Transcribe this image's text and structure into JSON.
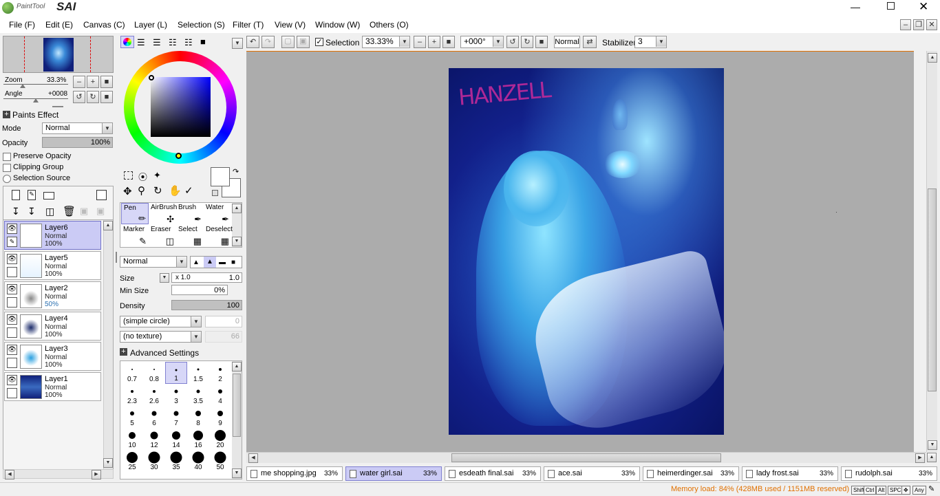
{
  "app": {
    "logo_small": "PaintTool",
    "logo_big": "SAI"
  },
  "menu": [
    "File (F)",
    "Edit (E)",
    "Canvas (C)",
    "Layer (L)",
    "Selection (S)",
    "Filter (T)",
    "View (V)",
    "Window (W)",
    "Others (O)"
  ],
  "navigator": {
    "zoom_label": "Zoom",
    "zoom_value": "33.3%",
    "angle_label": "Angle",
    "angle_value": "+0008"
  },
  "paints_effect": {
    "header": "Paints Effect",
    "mode_label": "Mode",
    "mode_value": "Normal",
    "opacity_label": "Opacity",
    "opacity_value": "100%",
    "opacity_fraction": 1.0
  },
  "layer_options": {
    "preserve_opacity": "Preserve Opacity",
    "clipping_group": "Clipping Group",
    "selection_source": "Selection Source"
  },
  "layers": [
    {
      "name": "Layer6",
      "mode": "Normal",
      "opacity": "100%",
      "active": true
    },
    {
      "name": "Layer5",
      "mode": "Normal",
      "opacity": "100%",
      "active": false
    },
    {
      "name": "Layer2",
      "mode": "Normal",
      "opacity": "50%",
      "active": false
    },
    {
      "name": "Layer4",
      "mode": "Normal",
      "opacity": "100%",
      "active": false
    },
    {
      "name": "Layer3",
      "mode": "Normal",
      "opacity": "100%",
      "active": false
    },
    {
      "name": "Layer1",
      "mode": "Normal",
      "opacity": "100%",
      "active": false
    }
  ],
  "tools": [
    {
      "name": "Pen",
      "icon": "pen-icon",
      "active": true
    },
    {
      "name": "AirBrush",
      "icon": "airbrush-icon",
      "active": false
    },
    {
      "name": "Brush",
      "icon": "brush-icon",
      "active": false
    },
    {
      "name": "Water",
      "icon": "water-icon",
      "active": false
    },
    {
      "name": "Marker",
      "icon": "marker-icon",
      "active": false
    },
    {
      "name": "Eraser",
      "icon": "eraser-icon",
      "active": false
    },
    {
      "name": "Select",
      "icon": "select-icon",
      "active": false
    },
    {
      "name": "Deselect",
      "icon": "deselect-icon",
      "active": false
    }
  ],
  "brush": {
    "blend_mode": "Normal",
    "size_label": "Size",
    "size_multiplier": "x 1.0",
    "size_value": "1.0",
    "min_size_label": "Min Size",
    "min_size_value": "0%",
    "density_label": "Density",
    "density_value": "100",
    "shape": "(simple circle)",
    "shape_value": "0",
    "texture": "(no texture)",
    "texture_value": "66",
    "advanced": "Advanced Settings"
  },
  "brush_sizes": [
    "0.7",
    "0.8",
    "1",
    "1.5",
    "2",
    "2.3",
    "2.6",
    "3",
    "3.5",
    "4",
    "5",
    "6",
    "7",
    "8",
    "9",
    "10",
    "12",
    "14",
    "16",
    "20",
    "25",
    "30",
    "35",
    "40",
    "50"
  ],
  "brush_selected": "1",
  "toolbar": {
    "selection_label": "Selection",
    "selection_checked": true,
    "zoom": "33.33%",
    "angle": "+000°",
    "mode": "Normal",
    "stabilizer_label": "Stabilizer",
    "stabilizer_value": "3"
  },
  "canvas_text": "HANZELL",
  "tabs": [
    {
      "name": "me shopping.jpg",
      "zoom": "33%",
      "active": false
    },
    {
      "name": "water girl.sai",
      "zoom": "33%",
      "active": true
    },
    {
      "name": "esdeath final.sai",
      "zoom": "33%",
      "active": false
    },
    {
      "name": "ace.sai",
      "zoom": "33%",
      "active": false
    },
    {
      "name": "heimerdinger.sai",
      "zoom": "33%",
      "active": false
    },
    {
      "name": "lady frost.sai",
      "zoom": "33%",
      "active": false
    },
    {
      "name": "rudolph.sai",
      "zoom": "33%",
      "active": false
    }
  ],
  "status": {
    "memory": "Memory load: 84% (428MB used / 1151MB reserved)",
    "memory_color": "#e07000",
    "keys": [
      "Shift",
      "Ctrl",
      "Alt",
      "SPC",
      "Any"
    ]
  },
  "colors": {
    "accent": "#7070c8",
    "canvas_bg": "#acacac"
  }
}
